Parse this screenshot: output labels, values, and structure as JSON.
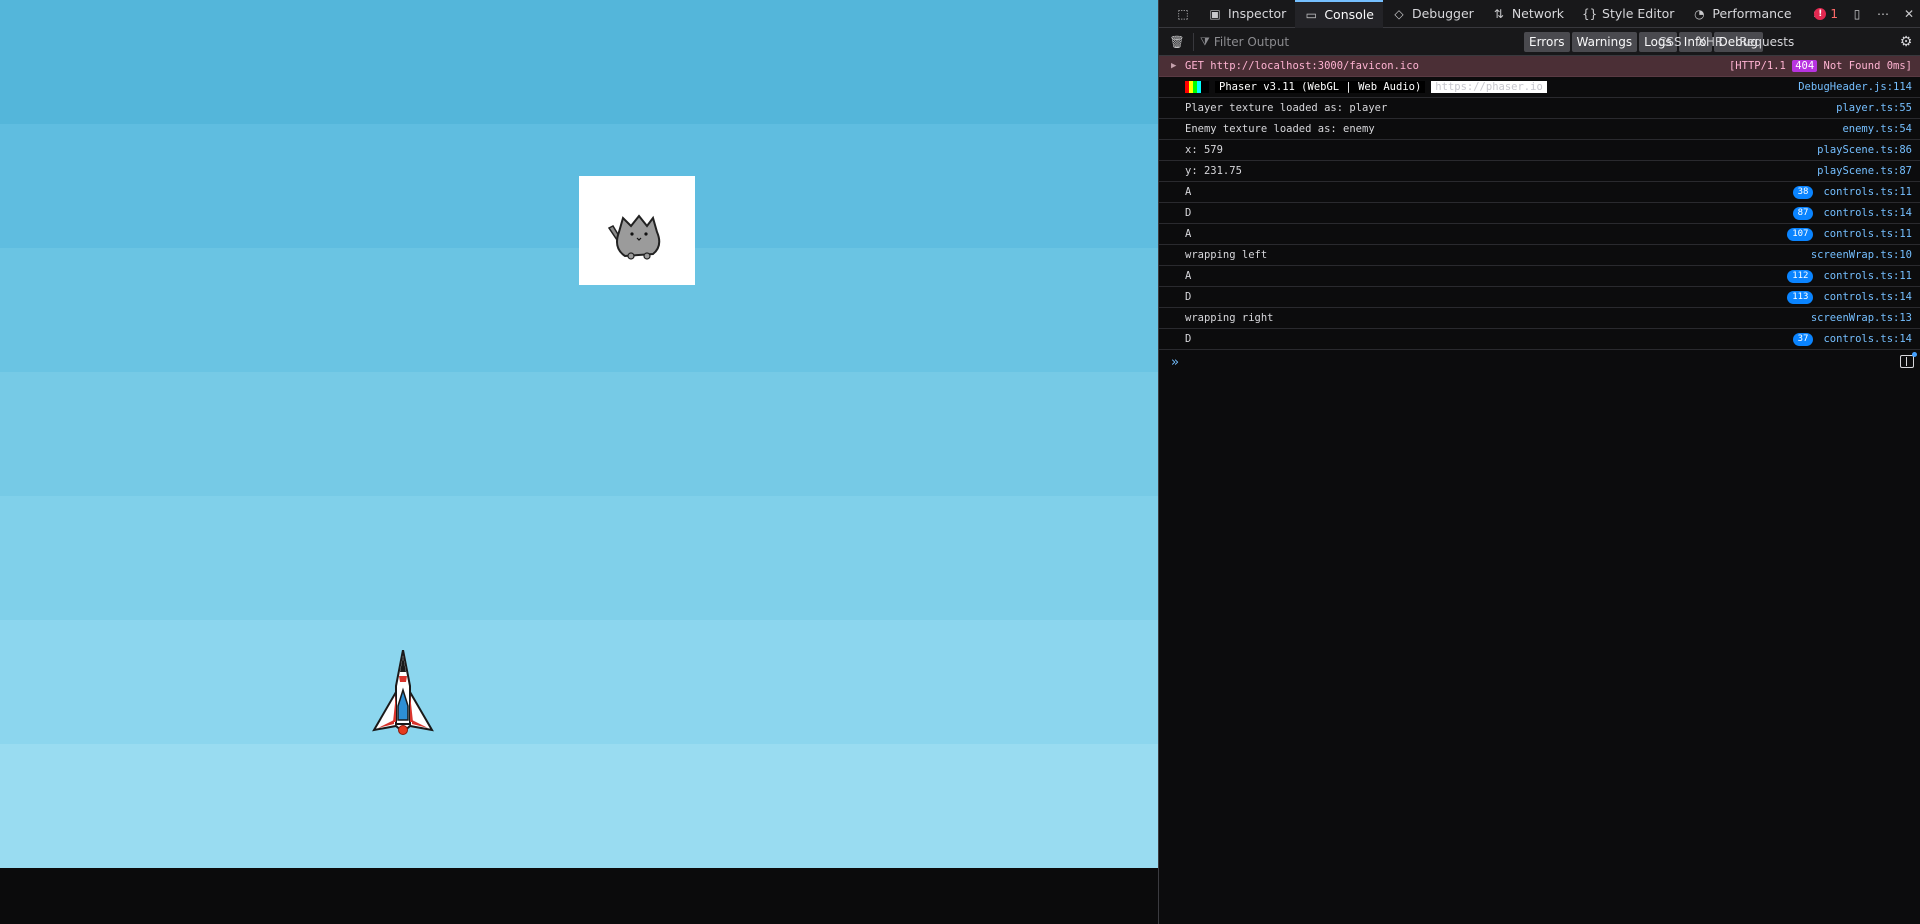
{
  "game": {
    "bands": [
      "#54b6da",
      "#5fbde0",
      "#6ac4e3",
      "#76cae6",
      "#80d0ea",
      "#8cd6ee",
      "#99dcf1"
    ]
  },
  "devtools": {
    "tabs": [
      {
        "label": "Inspector",
        "icon": "inspector-icon",
        "active": false
      },
      {
        "label": "Console",
        "icon": "console-icon",
        "active": true
      },
      {
        "label": "Debugger",
        "icon": "debugger-icon",
        "active": false
      },
      {
        "label": "Network",
        "icon": "network-icon",
        "active": false
      },
      {
        "label": "Style Editor",
        "icon": "style-editor-icon",
        "active": false
      },
      {
        "label": "Performance",
        "icon": "performance-icon",
        "active": false
      }
    ],
    "error_count": "1",
    "filter_placeholder": "Filter Output",
    "levels": [
      "Errors",
      "Warnings",
      "Logs",
      "Info",
      "Debug"
    ],
    "types": [
      "CSS",
      "XHR",
      "Requests"
    ],
    "messages": [
      {
        "kind": "error",
        "text": "GET http://localhost:3000/favicon.ico",
        "source": "[HTTP/1.1 ",
        "status": "404",
        "status_rest": " Not Found 0ms]"
      },
      {
        "kind": "phaser",
        "name": "Phaser v3.11 (WebGL | Web Audio)",
        "link": "https://phaser.io",
        "source": "DebugHeader.js:114"
      },
      {
        "kind": "log",
        "text": "Player texture loaded as: player",
        "source": "player.ts:55"
      },
      {
        "kind": "log",
        "text": "Enemy texture loaded as: enemy",
        "source": "enemy.ts:54"
      },
      {
        "kind": "log",
        "text": "x: 579",
        "source": "playScene.ts:86"
      },
      {
        "kind": "log",
        "text": "y: 231.75",
        "source": "playScene.ts:87"
      },
      {
        "kind": "log",
        "text": "A",
        "count": "38",
        "source": "controls.ts:11"
      },
      {
        "kind": "log",
        "text": "D",
        "count": "87",
        "source": "controls.ts:14"
      },
      {
        "kind": "log",
        "text": "A",
        "count": "107",
        "source": "controls.ts:11"
      },
      {
        "kind": "log",
        "text": "wrapping left",
        "source": "screenWrap.ts:10"
      },
      {
        "kind": "log",
        "text": "A",
        "count": "112",
        "source": "controls.ts:11"
      },
      {
        "kind": "log",
        "text": "D",
        "count": "113",
        "source": "controls.ts:14"
      },
      {
        "kind": "log",
        "text": "wrapping right",
        "source": "screenWrap.ts:13"
      },
      {
        "kind": "log",
        "text": "D",
        "count": "37",
        "source": "controls.ts:14"
      }
    ],
    "prompt_glyph": "»"
  }
}
